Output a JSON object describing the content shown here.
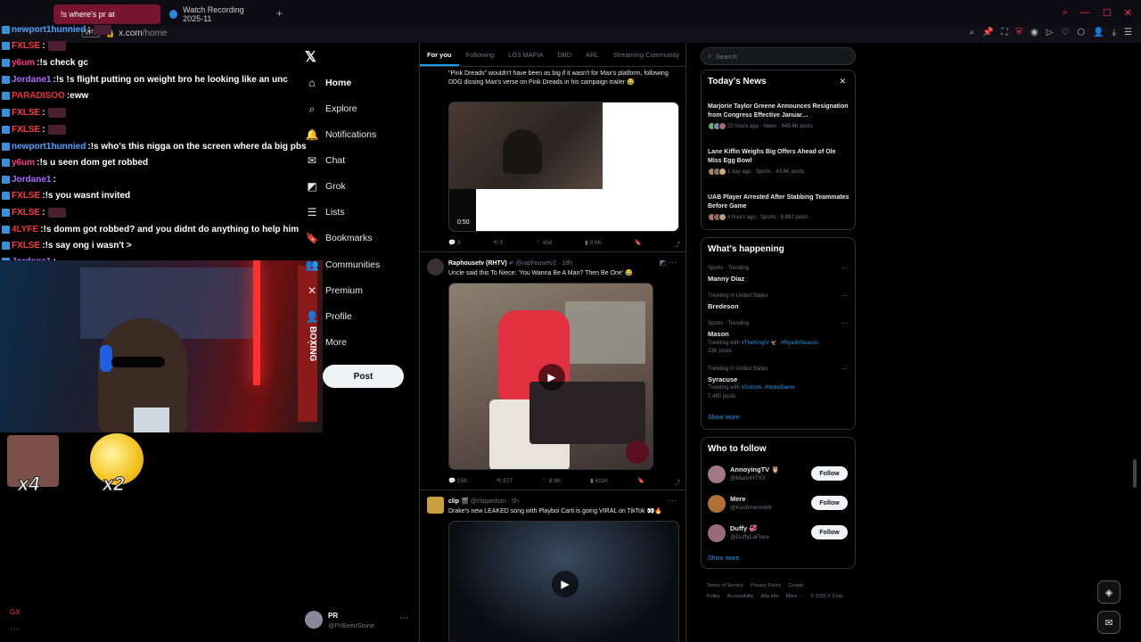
{
  "browser": {
    "tabs": [
      {
        "label": "!s where's pr at",
        "active": true
      },
      {
        "label": "Watch Recording 2025-11",
        "active": false
      }
    ],
    "new_tab_label": "+",
    "url_vpn": "VPN",
    "url_host": "x.com",
    "url_path": "/home",
    "accent": "#ff2d55"
  },
  "chat": {
    "messages": [
      {
        "user": "newport1hunnied",
        "text": "",
        "color": "#4fa3ff",
        "emote": true
      },
      {
        "user": "FXLSE",
        "text": "",
        "color": "#ff3b3b",
        "emote": true
      },
      {
        "user": "y6um",
        "text": "!s check gc",
        "color": "#ff3b8a",
        "emote": false
      },
      {
        "user": "Jordane1",
        "text": "!s !s flight putting on weight bro he looking like an unc",
        "color": "#b06aff",
        "emote": false
      },
      {
        "user": "PARADISOO",
        "text": "eww",
        "color": "#e33",
        "emote": false
      },
      {
        "user": "FXLSE",
        "text": "",
        "color": "#ff3b3b",
        "emote": true
      },
      {
        "user": "FXLSE",
        "text": "",
        "color": "#ff3b3b",
        "emote": true
      },
      {
        "user": "newport1hunnied",
        "text": "!s who's this nigga on the screen where da big pbs",
        "color": "#4fa3ff",
        "emote": false
      },
      {
        "user": "y6um",
        "text": "!s u seen dom get robbed",
        "color": "#ff3b8a",
        "emote": false
      },
      {
        "user": "Jordane1",
        "text": "",
        "color": "#b06aff",
        "emote": false
      },
      {
        "user": "FXLSE",
        "text": "!s you wasnt invited",
        "color": "#ff3b3b",
        "emote": false
      },
      {
        "user": "FXLSE",
        "text": "",
        "color": "#ff3b3b",
        "emote": true
      },
      {
        "user": "4LYFE",
        "text": "!s domm got robbed? and you didnt do anything to help him",
        "color": "#e33",
        "emote": false
      },
      {
        "user": "FXLSE",
        "text": "!s say ong i wasn't >",
        "color": "#ff3b3b",
        "emote": false
      },
      {
        "user": "Jordane1",
        "text": "",
        "color": "#b06aff",
        "emote": false
      }
    ]
  },
  "stream": {
    "sign_text": "BOXING",
    "mult_left": "x4",
    "mult_right": "x2",
    "gx_label": "GX"
  },
  "xnav": {
    "items": [
      {
        "label": "Home",
        "icon": "home-icon",
        "glyph": "⌂"
      },
      {
        "label": "Explore",
        "icon": "search-icon",
        "glyph": "⌕"
      },
      {
        "label": "Notifications",
        "icon": "bell-icon",
        "glyph": "🔔"
      },
      {
        "label": "Chat",
        "icon": "mail-icon",
        "glyph": "✉"
      },
      {
        "label": "Grok",
        "icon": "grok-icon",
        "glyph": "◩"
      },
      {
        "label": "Lists",
        "icon": "list-icon",
        "glyph": "☰"
      },
      {
        "label": "Bookmarks",
        "icon": "bookmark-icon",
        "glyph": "🔖"
      },
      {
        "label": "Communities",
        "icon": "people-icon",
        "glyph": "👥"
      },
      {
        "label": "Premium",
        "icon": "x-premium-icon",
        "glyph": "✕"
      },
      {
        "label": "Profile",
        "icon": "person-icon",
        "glyph": "👤"
      },
      {
        "label": "More",
        "icon": "more-circle-icon",
        "glyph": "⋯"
      }
    ],
    "post_label": "Post",
    "account_name": "PR",
    "account_handle": "@PrBeenStone"
  },
  "timeline": {
    "tabs": [
      "For you",
      "Following",
      "LG3 MAFIA",
      "DBD",
      "ARL",
      "Streaming Community"
    ],
    "post1": {
      "text": "\"Pink Dreads\" wouldn't have been as big if it wasn't for Max's platform, following DDG dissing Max's verse on Pink Dreads in his campaign trailer 😂",
      "video_time": "0:50",
      "replies": "3",
      "reposts": "5",
      "likes": "458",
      "views": "9.9K"
    },
    "post2": {
      "name": "Raphousetv (RHTV)",
      "handle": "@raphousetv2 · 18h",
      "text": "Uncle said this To Niece: 'You Wanna Be A Man? Then Be One' 😂",
      "replies": "158",
      "reposts": "877",
      "likes": "8.9K",
      "views": "411K"
    },
    "post3": {
      "name": "clip 🎬",
      "handle": "@clippedszn · 5h",
      "text": "Drake's new LEAKED song with Playboi Carti is going VIRAL on TikTok 👀🔥"
    }
  },
  "right": {
    "search_placeholder": "Search",
    "news_title": "Today's News",
    "news": [
      {
        "title": "Marjorie Taylor Greene Announces Resignation from Congress Effective Januar…",
        "meta": "22 hours ago · News · 649.4K posts"
      },
      {
        "title": "Lane Kiffin Weighs Big Offers Ahead of Ole Miss Egg Bowl",
        "meta": "1 day ago · Sports · 43.6K posts"
      },
      {
        "title": "UAB Player Arrested After Stabbing Teammates Before Game",
        "meta": "4 hours ago · Sports · 6,892 posts"
      }
    ],
    "happening_title": "What's happening",
    "trends": [
      {
        "cat": "Sports · Trending",
        "name": "Manny Diaz",
        "sub": "",
        "tags": ""
      },
      {
        "cat": "Trending in United States",
        "name": "Bredeson",
        "sub": "",
        "tags": ""
      },
      {
        "cat": "Sports · Trending",
        "name": "Mason",
        "sub": "Trending with",
        "tags": "#TheKingIV 🦅, #RiyadhSeason",
        "posts": "33K posts"
      },
      {
        "cat": "Trending in United States",
        "name": "Syracuse",
        "sub": "Trending with",
        "tags": "#GoIrish, #NotreDame",
        "posts": "7,480 posts"
      }
    ],
    "show_more": "Show more",
    "wtf_title": "Who to follow",
    "follow": [
      {
        "name": "AnnoyingTV 🦉",
        "handle": "@MarioHTXX",
        "button": "Follow"
      },
      {
        "name": "Mere",
        "handle": "@KashmereWill",
        "button": "Follow"
      },
      {
        "name": "Duffy 💞",
        "handle": "@DuffyLaFlare",
        "button": "Follow"
      }
    ],
    "footer": [
      "Terms of Service",
      "Privacy Policy",
      "Cookie Policy",
      "Accessibility",
      "Ads info",
      "More ···",
      "© 2025 X Corp."
    ]
  }
}
